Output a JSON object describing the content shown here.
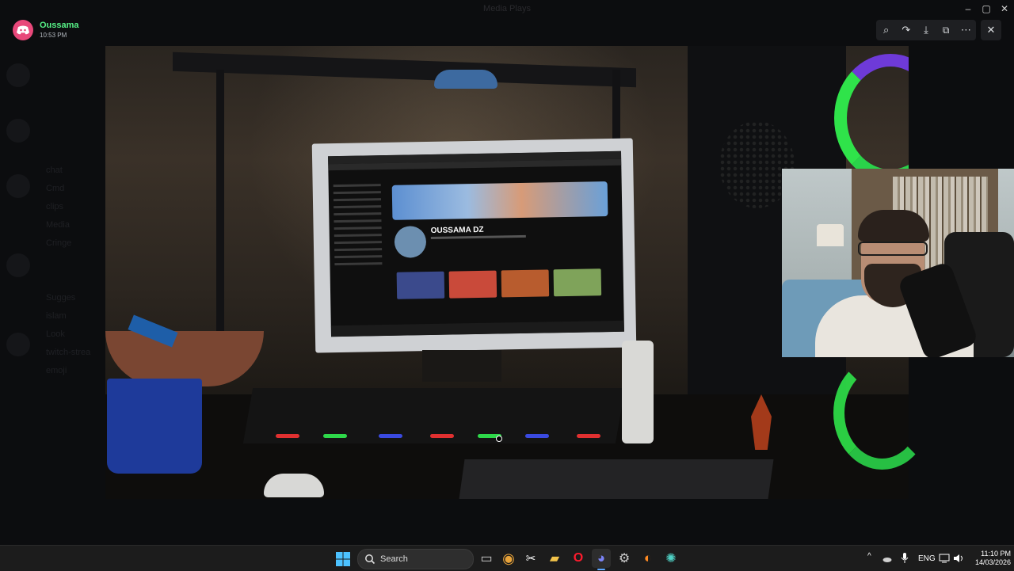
{
  "background_app": {
    "title": "Media Plays",
    "window_controls": [
      "–",
      "▢",
      "✕"
    ],
    "channels": [
      "chat",
      "Cmd",
      "clips",
      "Media",
      "Cringe",
      "Sugges",
      "islam",
      "Look",
      "twitch-strea",
      "emoji"
    ]
  },
  "viewer": {
    "author": "Oussama",
    "timestamp": "10:53 PM",
    "toolbar": [
      {
        "name": "zoom-icon",
        "glyph": "⌕"
      },
      {
        "name": "forward-icon",
        "glyph": "↷"
      },
      {
        "name": "download-icon",
        "glyph": "⤓"
      },
      {
        "name": "open-external-icon",
        "glyph": "⧉"
      },
      {
        "name": "more-icon",
        "glyph": "⋯"
      }
    ],
    "close_glyph": "✕"
  },
  "media": {
    "screen_channel_name": "OUSSAMA DZ"
  },
  "taskbar": {
    "search_label": "Search",
    "language": "ENG",
    "time": "11:10 PM",
    "date": "14/03/2026",
    "apps": [
      {
        "name": "task-view-icon",
        "glyph": "▭",
        "color": "#d0d0d0"
      },
      {
        "name": "chrome-icon",
        "glyph": "◉",
        "color": "#e8a33a"
      },
      {
        "name": "snipping-tool-icon",
        "glyph": "✂",
        "color": "#ffffff"
      },
      {
        "name": "file-explorer-icon",
        "glyph": "▰",
        "color": "#f2c34a"
      },
      {
        "name": "opera-icon",
        "glyph": "O",
        "color": "#ff1b2d"
      },
      {
        "name": "discord-icon",
        "glyph": "◕",
        "color": "#7b83f5"
      },
      {
        "name": "settings-icon",
        "glyph": "⚙",
        "color": "#cfcfcf"
      },
      {
        "name": "firefox-icon",
        "glyph": "◐",
        "color": "#ff8a22"
      },
      {
        "name": "chatgpt-icon",
        "glyph": "✺",
        "color": "#4fd1c5"
      }
    ]
  },
  "colors": {
    "accent_green": "#57f287",
    "discord_pink": "#e8487a",
    "rgb_green": "#2fe34a"
  }
}
